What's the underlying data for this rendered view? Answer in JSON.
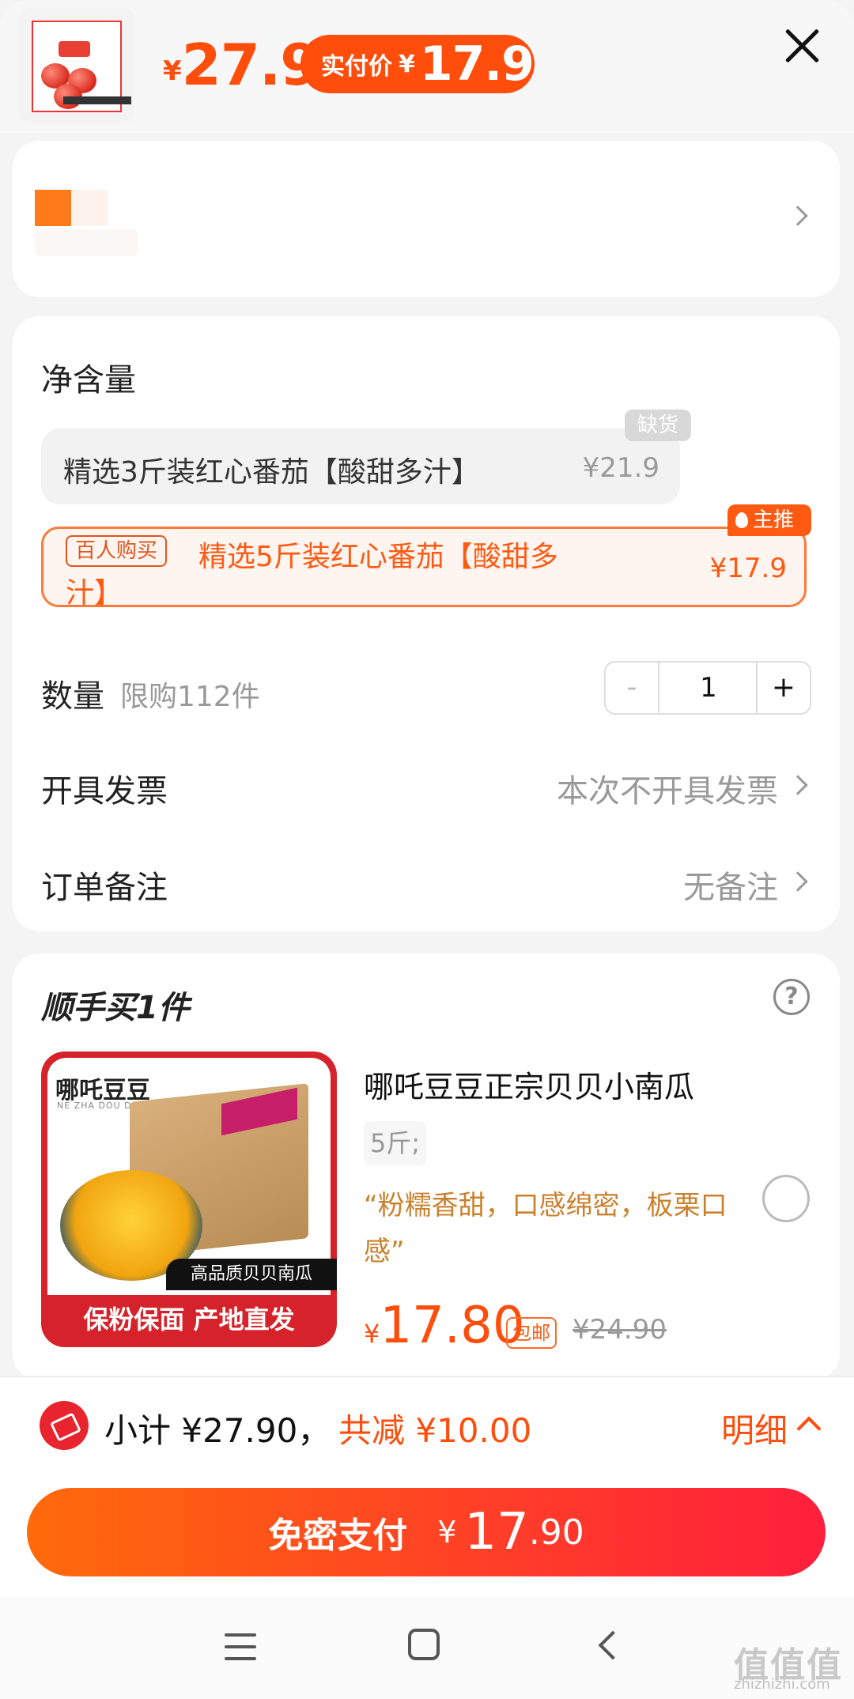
{
  "header": {
    "price_currency": "¥",
    "price": "27.9",
    "pay_label": "实付价",
    "pay_currency": "¥",
    "pay_price": "17.9"
  },
  "spec": {
    "section_title": "净含量",
    "options": [
      {
        "label": "精选3斤装红心番茄【酸甜多汁】",
        "price": "¥21.9",
        "badge": "缺货",
        "selected": false
      },
      {
        "label_line1": "精选5斤装红心番茄【酸甜多",
        "label_line2": "汁】",
        "price": "¥17.9",
        "tag": "百人购买",
        "badge": "主推",
        "selected": true
      }
    ],
    "quantity": {
      "label": "数量",
      "limit": "限购112件",
      "value": "1",
      "minus": "-",
      "plus": "+"
    },
    "invoice": {
      "label": "开具发票",
      "value": "本次不开具发票"
    },
    "note": {
      "label": "订单备注",
      "value": "无备注"
    }
  },
  "addon": {
    "title": "顺手买1件",
    "help_icon": "?",
    "product": {
      "image_brand": "哪吒豆豆",
      "image_brand_sub": "NE ZHA DOU DOU",
      "image_tag": "高品质贝贝南瓜",
      "image_banner": "保粉保面  产地直发",
      "title": "哪吒豆豆正宗贝贝小南瓜",
      "spec": "5斤;",
      "desc": "“粉糯香甜，口感绵密，板栗口感”",
      "currency": "¥",
      "price": "17.80",
      "shipping": "包邮",
      "original_price": "¥24.90"
    }
  },
  "summary": {
    "subtotal": "小计 ¥27.90，",
    "discount": "共减 ¥10.00",
    "detail": "明细"
  },
  "pay_button": {
    "label": "免密支付",
    "currency": "¥",
    "amount_int": "17",
    "amount_dec": ".90"
  },
  "watermark": {
    "text": "值值值",
    "url": "zhizhizhi.com"
  },
  "colors": {
    "accent": "#ff4d0c",
    "gold": "#c9812e",
    "gradient_end": "#ff1f3c"
  }
}
